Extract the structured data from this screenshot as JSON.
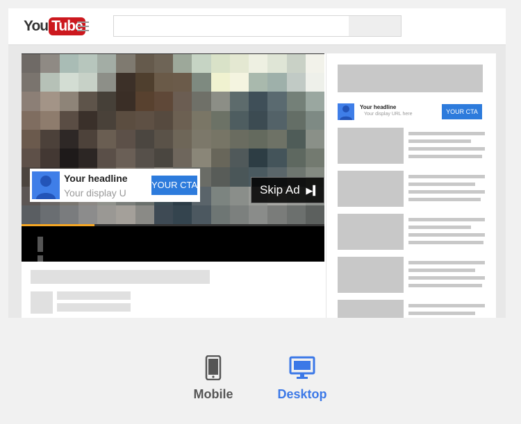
{
  "youtube": {
    "logo_you": "You",
    "logo_tube": "Tube",
    "search_placeholder": ""
  },
  "ad": {
    "headline": "Your headline",
    "display_url": "Your display URL here",
    "display_url_truncated": "Your display U",
    "cta": "YOUR CTA",
    "skip_label": "Skip Ad",
    "progress_fraction": 0.24
  },
  "side_ad": {
    "headline": "Your headline",
    "display_url": "Your display URL here",
    "cta": "YOUR CTA"
  },
  "preview_switcher": {
    "mobile_label": "Mobile",
    "desktop_label": "Desktop",
    "selected": "Desktop"
  },
  "colors": {
    "youtube_red": "#cc181e",
    "cta_blue": "#2d7bdc",
    "selected_blue": "#3b78e7",
    "progress_yellow": "#f5a623"
  },
  "icons": {
    "hamburger": "menu-icon",
    "pause": "pause-icon",
    "skip": "skip-next-icon",
    "mobile": "mobile-phone-icon",
    "desktop": "desktop-monitor-icon",
    "avatar": "person-icon"
  }
}
